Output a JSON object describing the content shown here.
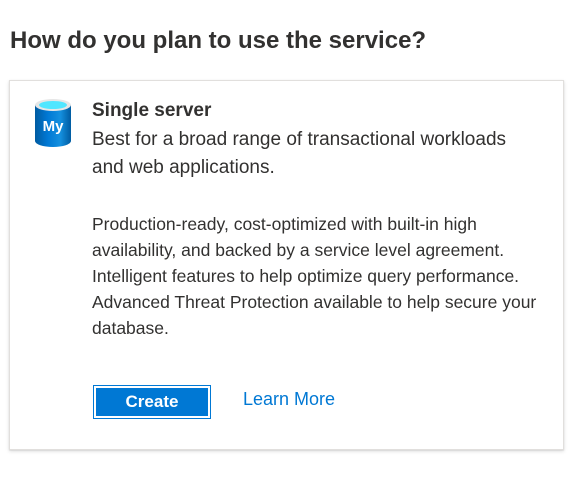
{
  "page": {
    "title": "How do you plan to use the service?"
  },
  "card": {
    "icon": "mysql-database-icon",
    "icon_text": "My",
    "title": "Single server",
    "subtitle": "Best for a broad range of transactional workloads and web applications.",
    "description": "Production-ready, cost-optimized with built-in high availability, and backed by a service level agreement. Intelligent features to help optimize query performance. Advanced Threat Protection available to help secure your database.",
    "create_label": "Create",
    "learn_more_label": "Learn More"
  },
  "colors": {
    "accent": "#0078d4",
    "text": "#323130",
    "card_border": "#e1dfdd"
  }
}
